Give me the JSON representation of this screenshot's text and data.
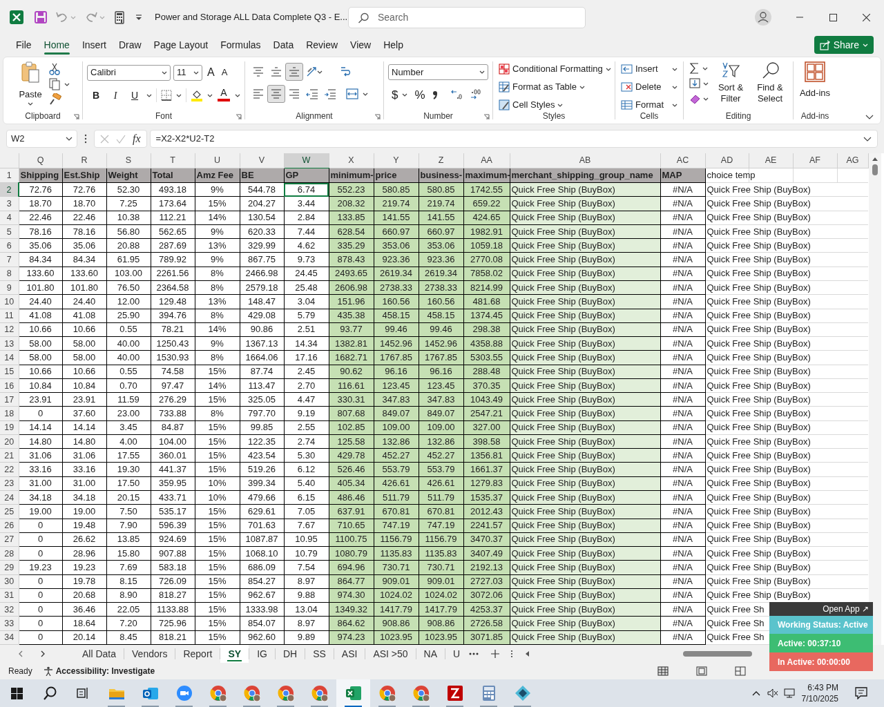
{
  "title_bar": {
    "title": "Power and Storage ALL Data Complete Q3  -  E...",
    "search_placeholder": "Search"
  },
  "menu_tabs": [
    {
      "label": "File",
      "selected": false
    },
    {
      "label": "Home",
      "selected": true
    },
    {
      "label": "Insert",
      "selected": false
    },
    {
      "label": "Draw",
      "selected": false
    },
    {
      "label": "Page Layout",
      "selected": false
    },
    {
      "label": "Formulas",
      "selected": false
    },
    {
      "label": "Data",
      "selected": false
    },
    {
      "label": "Review",
      "selected": false
    },
    {
      "label": "View",
      "selected": false
    },
    {
      "label": "Help",
      "selected": false
    }
  ],
  "share": "Share",
  "ribbon": {
    "clipboard": {
      "paste": "Paste",
      "label": "Clipboard"
    },
    "font": {
      "name": "Calibri",
      "size": "11",
      "grow": "A",
      "shrink": "A",
      "bold": "B",
      "italic": "I",
      "underline": "U",
      "font_color_button": "A",
      "label": "Font"
    },
    "alignment": {
      "buttons": [
        {
          "kind": "top",
          "selected": false
        },
        {
          "kind": "middle",
          "selected": false
        },
        {
          "kind": "bottom",
          "selected": true
        },
        {
          "kind": "left",
          "selected": false
        },
        {
          "kind": "center",
          "selected": true
        },
        {
          "kind": "right",
          "selected": false
        }
      ],
      "label": "Alignment"
    },
    "number": {
      "format": "Number",
      "currency": "$",
      "percent": "%",
      "label": "Number"
    },
    "styles": {
      "items": [
        "Conditional Formatting",
        "Format as Table",
        "Cell Styles"
      ],
      "label": "Styles"
    },
    "cells": {
      "items": [
        "Insert",
        "Delete",
        "Format"
      ],
      "label": "Cells"
    },
    "editing": {
      "sort": "Sort & Filter",
      "find": "Find & Select",
      "label": "Editing"
    },
    "addins": {
      "button": "Add-ins",
      "label": "Add-ins"
    }
  },
  "formula_bar": {
    "name_box": "W2",
    "fx": "fx",
    "formula": "=X2-X2*U2-T2"
  },
  "sheet": {
    "columns": [
      {
        "letter": "Q",
        "selected": false
      },
      {
        "letter": "R",
        "selected": false
      },
      {
        "letter": "S",
        "selected": false
      },
      {
        "letter": "T",
        "selected": false
      },
      {
        "letter": "U",
        "selected": false
      },
      {
        "letter": "V",
        "selected": false
      },
      {
        "letter": "W",
        "selected": true
      },
      {
        "letter": "X",
        "selected": false
      },
      {
        "letter": "Y",
        "selected": false
      },
      {
        "letter": "Z",
        "selected": false
      },
      {
        "letter": "AA",
        "selected": false
      },
      {
        "letter": "AB",
        "selected": false
      },
      {
        "letter": "AC",
        "selected": false
      },
      {
        "letter": "AD",
        "selected": false
      },
      {
        "letter": "AE",
        "selected": false
      },
      {
        "letter": "AF",
        "selected": false
      },
      {
        "letter": "AG",
        "selected": false
      }
    ],
    "header_row": {
      "n": "1",
      "cells": [
        "Shipping",
        "Est.Ship",
        "Weight",
        "Total",
        "Amz Fee",
        "BE",
        "GP",
        "minimum-",
        "price",
        "business-",
        "maximum-",
        "merchant_shipping_group_name",
        "MAP",
        "choice temp"
      ]
    },
    "rows": [
      {
        "n": "2",
        "selected": true,
        "cells": [
          "72.76",
          "72.76",
          "52.30",
          "493.18",
          "9%",
          "544.78",
          "6.74",
          "552.23",
          "580.85",
          "580.85",
          "1742.55",
          "Quick Free Ship (BuyBox)",
          "#N/A",
          "Quick Free Ship (BuyBox)"
        ]
      },
      {
        "n": "3",
        "selected": false,
        "cells": [
          "18.70",
          "18.70",
          "7.25",
          "173.64",
          "15%",
          "204.27",
          "3.44",
          "208.32",
          "219.74",
          "219.74",
          "659.22",
          "Quick Free Ship (BuyBox)",
          "#N/A",
          "Quick Free Ship (BuyBox)"
        ]
      },
      {
        "n": "4",
        "selected": false,
        "cells": [
          "22.46",
          "22.46",
          "10.38",
          "112.21",
          "14%",
          "130.54",
          "2.84",
          "133.85",
          "141.55",
          "141.55",
          "424.65",
          "Quick Free Ship (BuyBox)",
          "#N/A",
          "Quick Free Ship (BuyBox)"
        ]
      },
      {
        "n": "5",
        "selected": false,
        "cells": [
          "78.16",
          "78.16",
          "56.80",
          "562.65",
          "9%",
          "620.33",
          "7.44",
          "628.54",
          "660.97",
          "660.97",
          "1982.91",
          "Quick Free Ship (BuyBox)",
          "#N/A",
          "Quick Free Ship (BuyBox)"
        ]
      },
      {
        "n": "6",
        "selected": false,
        "cells": [
          "35.06",
          "35.06",
          "20.88",
          "287.69",
          "13%",
          "329.99",
          "4.62",
          "335.29",
          "353.06",
          "353.06",
          "1059.18",
          "Quick Free Ship (BuyBox)",
          "#N/A",
          "Quick Free Ship (BuyBox)"
        ]
      },
      {
        "n": "7",
        "selected": false,
        "cells": [
          "84.34",
          "84.34",
          "61.95",
          "789.92",
          "9%",
          "867.75",
          "9.73",
          "878.43",
          "923.36",
          "923.36",
          "2770.08",
          "Quick Free Ship (BuyBox)",
          "#N/A",
          "Quick Free Ship (BuyBox)"
        ]
      },
      {
        "n": "8",
        "selected": false,
        "cells": [
          "133.60",
          "133.60",
          "103.00",
          "2261.56",
          "8%",
          "2466.98",
          "24.45",
          "2493.65",
          "2619.34",
          "2619.34",
          "7858.02",
          "Quick Free Ship (BuyBox)",
          "#N/A",
          "Quick Free Ship (BuyBox)"
        ]
      },
      {
        "n": "9",
        "selected": false,
        "cells": [
          "101.80",
          "101.80",
          "76.50",
          "2364.58",
          "8%",
          "2579.18",
          "25.48",
          "2606.98",
          "2738.33",
          "2738.33",
          "8214.99",
          "Quick Free Ship (BuyBox)",
          "#N/A",
          "Quick Free Ship (BuyBox)"
        ]
      },
      {
        "n": "10",
        "selected": false,
        "cells": [
          "24.40",
          "24.40",
          "12.00",
          "129.48",
          "13%",
          "148.47",
          "3.04",
          "151.96",
          "160.56",
          "160.56",
          "481.68",
          "Quick Free Ship (BuyBox)",
          "#N/A",
          "Quick Free Ship (BuyBox)"
        ]
      },
      {
        "n": "11",
        "selected": false,
        "cells": [
          "41.08",
          "41.08",
          "25.90",
          "394.76",
          "8%",
          "429.08",
          "5.79",
          "435.38",
          "458.15",
          "458.15",
          "1374.45",
          "Quick Free Ship (BuyBox)",
          "#N/A",
          "Quick Free Ship (BuyBox)"
        ]
      },
      {
        "n": "12",
        "selected": false,
        "cells": [
          "10.66",
          "10.66",
          "0.55",
          "78.21",
          "14%",
          "90.86",
          "2.51",
          "93.77",
          "99.46",
          "99.46",
          "298.38",
          "Quick Free Ship (BuyBox)",
          "#N/A",
          "Quick Free Ship (BuyBox)"
        ]
      },
      {
        "n": "13",
        "selected": false,
        "cells": [
          "58.00",
          "58.00",
          "40.00",
          "1250.43",
          "9%",
          "1367.13",
          "14.34",
          "1382.81",
          "1452.96",
          "1452.96",
          "4358.88",
          "Quick Free Ship (BuyBox)",
          "#N/A",
          "Quick Free Ship (BuyBox)"
        ]
      },
      {
        "n": "14",
        "selected": false,
        "cells": [
          "58.00",
          "58.00",
          "40.00",
          "1530.93",
          "8%",
          "1664.06",
          "17.16",
          "1682.71",
          "1767.85",
          "1767.85",
          "5303.55",
          "Quick Free Ship (BuyBox)",
          "#N/A",
          "Quick Free Ship (BuyBox)"
        ]
      },
      {
        "n": "15",
        "selected": false,
        "cells": [
          "10.66",
          "10.66",
          "0.55",
          "74.58",
          "15%",
          "87.74",
          "2.45",
          "90.62",
          "96.16",
          "96.16",
          "288.48",
          "Quick Free Ship (BuyBox)",
          "#N/A",
          "Quick Free Ship (BuyBox)"
        ]
      },
      {
        "n": "16",
        "selected": false,
        "cells": [
          "10.84",
          "10.84",
          "0.70",
          "97.47",
          "14%",
          "113.47",
          "2.70",
          "116.61",
          "123.45",
          "123.45",
          "370.35",
          "Quick Free Ship (BuyBox)",
          "#N/A",
          "Quick Free Ship (BuyBox)"
        ]
      },
      {
        "n": "17",
        "selected": false,
        "cells": [
          "23.91",
          "23.91",
          "11.59",
          "276.29",
          "15%",
          "325.05",
          "4.47",
          "330.31",
          "347.83",
          "347.83",
          "1043.49",
          "Quick Free Ship (BuyBox)",
          "#N/A",
          "Quick Free Ship (BuyBox)"
        ]
      },
      {
        "n": "18",
        "selected": false,
        "cells": [
          "0",
          "37.60",
          "23.00",
          "733.88",
          "8%",
          "797.70",
          "9.19",
          "807.68",
          "849.07",
          "849.07",
          "2547.21",
          "Quick Free Ship (BuyBox)",
          "#N/A",
          "Quick Free Ship (BuyBox)"
        ]
      },
      {
        "n": "19",
        "selected": false,
        "cells": [
          "14.14",
          "14.14",
          "3.45",
          "84.87",
          "15%",
          "99.85",
          "2.55",
          "102.85",
          "109.00",
          "109.00",
          "327.00",
          "Quick Free Ship (BuyBox)",
          "#N/A",
          "Quick Free Ship (BuyBox)"
        ]
      },
      {
        "n": "20",
        "selected": false,
        "cells": [
          "14.80",
          "14.80",
          "4.00",
          "104.00",
          "15%",
          "122.35",
          "2.74",
          "125.58",
          "132.86",
          "132.86",
          "398.58",
          "Quick Free Ship (BuyBox)",
          "#N/A",
          "Quick Free Ship (BuyBox)"
        ]
      },
      {
        "n": "21",
        "selected": false,
        "cells": [
          "31.06",
          "31.06",
          "17.55",
          "360.01",
          "15%",
          "423.54",
          "5.30",
          "429.78",
          "452.27",
          "452.27",
          "1356.81",
          "Quick Free Ship (BuyBox)",
          "#N/A",
          "Quick Free Ship (BuyBox)"
        ]
      },
      {
        "n": "22",
        "selected": false,
        "cells": [
          "33.16",
          "33.16",
          "19.30",
          "441.37",
          "15%",
          "519.26",
          "6.12",
          "526.46",
          "553.79",
          "553.79",
          "1661.37",
          "Quick Free Ship (BuyBox)",
          "#N/A",
          "Quick Free Ship (BuyBox)"
        ]
      },
      {
        "n": "23",
        "selected": false,
        "cells": [
          "31.00",
          "31.00",
          "17.50",
          "359.95",
          "10%",
          "399.34",
          "5.40",
          "405.34",
          "426.61",
          "426.61",
          "1279.83",
          "Quick Free Ship (BuyBox)",
          "#N/A",
          "Quick Free Ship (BuyBox)"
        ]
      },
      {
        "n": "24",
        "selected": false,
        "cells": [
          "34.18",
          "34.18",
          "20.15",
          "433.71",
          "10%",
          "479.66",
          "6.15",
          "486.46",
          "511.79",
          "511.79",
          "1535.37",
          "Quick Free Ship (BuyBox)",
          "#N/A",
          "Quick Free Ship (BuyBox)"
        ]
      },
      {
        "n": "25",
        "selected": false,
        "cells": [
          "19.00",
          "19.00",
          "7.50",
          "535.17",
          "15%",
          "629.61",
          "7.05",
          "637.91",
          "670.81",
          "670.81",
          "2012.43",
          "Quick Free Ship (BuyBox)",
          "#N/A",
          "Quick Free Ship (BuyBox)"
        ]
      },
      {
        "n": "26",
        "selected": false,
        "cells": [
          "0",
          "19.48",
          "7.90",
          "596.39",
          "15%",
          "701.63",
          "7.67",
          "710.65",
          "747.19",
          "747.19",
          "2241.57",
          "Quick Free Ship (BuyBox)",
          "#N/A",
          "Quick Free Ship (BuyBox)"
        ]
      },
      {
        "n": "27",
        "selected": false,
        "cells": [
          "0",
          "26.62",
          "13.85",
          "924.69",
          "15%",
          "1087.87",
          "10.95",
          "1100.75",
          "1156.79",
          "1156.79",
          "3470.37",
          "Quick Free Ship (BuyBox)",
          "#N/A",
          "Quick Free Ship (BuyBox)"
        ]
      },
      {
        "n": "28",
        "selected": false,
        "cells": [
          "0",
          "28.96",
          "15.80",
          "907.88",
          "15%",
          "1068.10",
          "10.79",
          "1080.79",
          "1135.83",
          "1135.83",
          "3407.49",
          "Quick Free Ship (BuyBox)",
          "#N/A",
          "Quick Free Ship (BuyBox)"
        ]
      },
      {
        "n": "29",
        "selected": false,
        "cells": [
          "19.23",
          "19.23",
          "7.69",
          "583.18",
          "15%",
          "686.09",
          "7.54",
          "694.96",
          "730.71",
          "730.71",
          "2192.13",
          "Quick Free Ship (BuyBox)",
          "#N/A",
          "Quick Free Ship (BuyBox)"
        ]
      },
      {
        "n": "30",
        "selected": false,
        "cells": [
          "0",
          "19.78",
          "8.15",
          "726.09",
          "15%",
          "854.27",
          "8.97",
          "864.77",
          "909.01",
          "909.01",
          "2727.03",
          "Quick Free Ship (BuyBox)",
          "#N/A",
          "Quick Free Ship (BuyBox)"
        ]
      },
      {
        "n": "31",
        "selected": false,
        "cells": [
          "0",
          "20.68",
          "8.90",
          "818.27",
          "15%",
          "962.67",
          "9.88",
          "974.30",
          "1024.02",
          "1024.02",
          "3072.06",
          "Quick Free Ship (BuyBox)",
          "#N/A",
          "Quick Free Ship (BuyBox)"
        ]
      },
      {
        "n": "32",
        "selected": false,
        "cells": [
          "0",
          "36.46",
          "22.05",
          "1133.88",
          "15%",
          "1333.98",
          "13.04",
          "1349.32",
          "1417.79",
          "1417.79",
          "4253.37",
          "Quick Free Ship (BuyBox)",
          "#N/A",
          "Quick Free Sh"
        ]
      },
      {
        "n": "33",
        "selected": false,
        "cells": [
          "0",
          "18.64",
          "7.20",
          "725.96",
          "15%",
          "854.07",
          "8.97",
          "864.62",
          "908.86",
          "908.86",
          "2726.58",
          "Quick Free Ship (BuyBox)",
          "#N/A",
          "Quick Free Sh"
        ]
      },
      {
        "n": "34",
        "selected": false,
        "cells": [
          "0",
          "20.14",
          "8.45",
          "818.21",
          "15%",
          "962.60",
          "9.89",
          "974.23",
          "1023.95",
          "1023.95",
          "3071.85",
          "Quick Free Ship (BuyBox)",
          "#N/A",
          "Quick Free Sh"
        ]
      }
    ]
  },
  "sheet_tabs": [
    {
      "label": "All Data",
      "selected": false
    },
    {
      "label": "Vendors",
      "selected": false
    },
    {
      "label": "Report",
      "selected": false
    },
    {
      "label": "SY",
      "selected": true
    },
    {
      "label": "IG",
      "selected": false
    },
    {
      "label": "DH",
      "selected": false
    },
    {
      "label": "SS",
      "selected": false
    },
    {
      "label": "ASI",
      "selected": false
    },
    {
      "label": "ASI >50",
      "selected": false
    },
    {
      "label": "NA",
      "selected": false
    },
    {
      "label": "U",
      "selected": false
    }
  ],
  "status_bar": {
    "mode": "Ready",
    "accessibility": "Accessibility: Investigate"
  },
  "tracker": {
    "open_app": "Open App ↗",
    "working_status": "Working Status: Active",
    "active": "Active: 00:37:10",
    "inactive": "In Active: 00:00:00"
  },
  "taskbar": {
    "apps": [
      {
        "kind": "explorer",
        "selected": false
      },
      {
        "kind": "outlook",
        "selected": false
      },
      {
        "kind": "zoom",
        "selected": false
      },
      {
        "kind": "chrome",
        "selected": false
      },
      {
        "kind": "chrome",
        "selected": false
      },
      {
        "kind": "chrome",
        "selected": false
      },
      {
        "kind": "chrome",
        "selected": false
      },
      {
        "kind": "excel",
        "selected": true
      },
      {
        "kind": "chrome",
        "selected": false
      },
      {
        "kind": "chrome",
        "selected": false
      },
      {
        "kind": "filezilla",
        "selected": false
      },
      {
        "kind": "calculator",
        "selected": false
      },
      {
        "kind": "diamond",
        "selected": false
      }
    ],
    "time": "6:43 PM",
    "date": "7/10/2025"
  }
}
